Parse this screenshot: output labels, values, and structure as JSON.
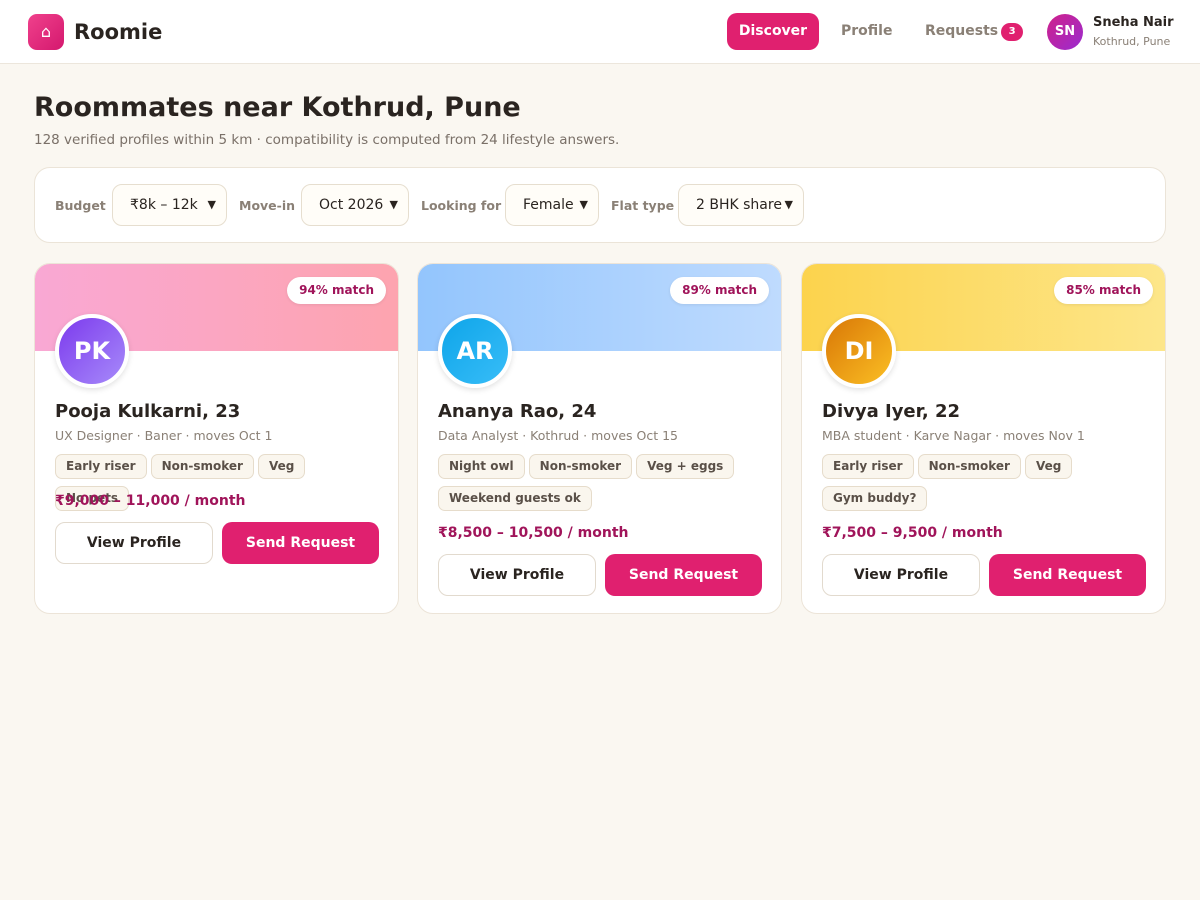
{
  "app": {
    "logo_icon": "home-icon",
    "brand": "Roomie"
  },
  "nav": {
    "discover": "Discover",
    "profile": "Profile",
    "requests": "Requests",
    "requests_count": "3"
  },
  "user": {
    "initials": "SN",
    "name": "Sneha Nair",
    "location": "Kothrud, Pune"
  },
  "header": {
    "title": "Roommates near Kothrud, Pune",
    "subtitle": "128 verified profiles within 5 km · compatibility is computed from 24 lifestyle answers."
  },
  "filters": {
    "budget_label": "Budget",
    "budget_value": "₹8k – 12k",
    "movein_label": "Move-in",
    "movein_value": "Oct 2026",
    "looking_label": "Looking for",
    "looking_value": "Female",
    "flat_label": "Flat type",
    "flat_value": "2 BHK share"
  },
  "colors": {
    "accent": "#e0206f",
    "price": "#a0145a",
    "background": "#faf7f1"
  },
  "cards": [
    {
      "match": "94% match",
      "initials": "PK",
      "name": "Pooja Kulkarni, 23",
      "meta": "UX Designer · Baner · moves Oct 1",
      "tags": [
        "Early riser",
        "Non-smoker",
        "Veg",
        "No pets"
      ],
      "price": "₹9,000 – 11,000 / month",
      "view_label": "View Profile",
      "send_label": "Send Request"
    },
    {
      "match": "89% match",
      "initials": "AR",
      "name": "Ananya Rao, 24",
      "meta": "Data Analyst · Kothrud · moves Oct 15",
      "tags": [
        "Night owl",
        "Non-smoker",
        "Veg + eggs",
        "Weekend guests ok"
      ],
      "price": "₹8,500 – 10,500 / month",
      "view_label": "View Profile",
      "send_label": "Send Request"
    },
    {
      "match": "85% match",
      "initials": "DI",
      "name": "Divya Iyer, 22",
      "meta": "MBA student · Karve Nagar · moves Nov 1",
      "tags": [
        "Early riser",
        "Non-smoker",
        "Veg",
        "Gym buddy?"
      ],
      "price": "₹7,500 – 9,500 / month",
      "view_label": "View Profile",
      "send_label": "Send Request"
    }
  ]
}
